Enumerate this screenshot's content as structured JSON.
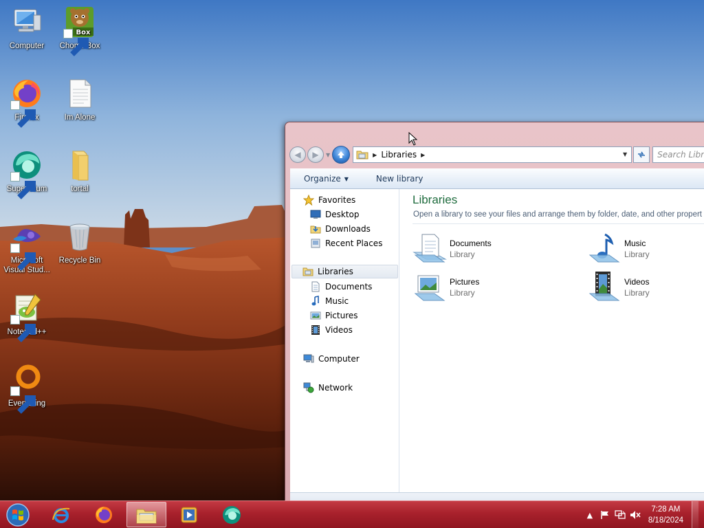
{
  "desktop": {
    "icons": [
      {
        "label": "Computer"
      },
      {
        "label": "ChomikBox"
      },
      {
        "label": "Firefox"
      },
      {
        "label": "Im Alone"
      },
      {
        "label": "Supermium"
      },
      {
        "label": "tortal"
      },
      {
        "label": "Microsoft Visual Stud..."
      },
      {
        "label": "Recycle Bin"
      },
      {
        "label": "Notepad++"
      },
      {
        "label": "Everything"
      }
    ],
    "chomik_badge": "Box"
  },
  "explorer": {
    "breadcrumb": "Libraries",
    "search_placeholder": "Search Libraries",
    "toolbar": {
      "organize_label": "Organize",
      "new_library_label": "New library"
    },
    "nav": {
      "favorites": "Favorites",
      "desktop": "Desktop",
      "downloads": "Downloads",
      "recent_places": "Recent Places",
      "libraries": "Libraries",
      "documents": "Documents",
      "music": "Music",
      "pictures": "Pictures",
      "videos": "Videos",
      "computer": "Computer",
      "network": "Network"
    },
    "main": {
      "title": "Libraries",
      "description": "Open a library to see your files and arrange them by folder, date, and other properties.",
      "items": [
        {
          "name": "Documents",
          "type": "Library"
        },
        {
          "name": "Music",
          "type": "Library"
        },
        {
          "name": "Pictures",
          "type": "Library"
        },
        {
          "name": "Videos",
          "type": "Library"
        }
      ]
    }
  },
  "taskbar": {
    "clock_time": "7:28 AM",
    "clock_date": "8/18/2024"
  },
  "colors": {
    "taskbar": "#a8212c",
    "library_title": "#1e6b3d",
    "window_frame": "#e6c0c5"
  }
}
